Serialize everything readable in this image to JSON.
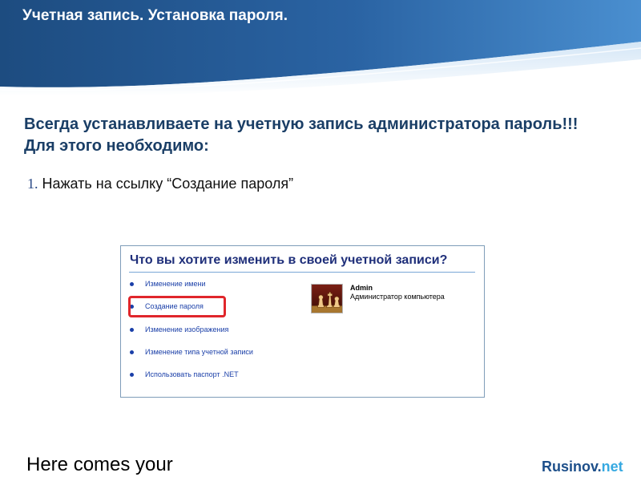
{
  "slide": {
    "title": "Учетная запись. Установка пароля.",
    "subtitle": "Всегда устанавливаете на учетную запись администратора пароль!!! Для этого необходимо:",
    "step_number": "1.",
    "step_text": " Нажать на ссылку “Создание пароля”"
  },
  "screenshot": {
    "heading": "Что вы хотите изменить в своей учетной записи?",
    "tasks": [
      {
        "label": "Изменение имени"
      },
      {
        "label": "Создание пароля"
      },
      {
        "label": "Изменение изображения"
      },
      {
        "label": "Изменение типа учетной записи"
      },
      {
        "label": "Использовать паспорт .NET"
      }
    ],
    "highlighted_task": "Создание пароля",
    "account": {
      "name": "Admin",
      "role": "Администратор компьютера",
      "avatar_icon": "chess-pieces-icon"
    }
  },
  "footer": {
    "text": "Here comes your",
    "brand_main": "Rusinov.",
    "brand_tld": "net"
  },
  "colors": {
    "banner_dark": "#1e4f86",
    "banner_light": "#3b7cc2",
    "subtitle": "#1a3e66",
    "link": "#1a3fa8",
    "highlight": "#e0262b",
    "brand": "#1d4f8a",
    "brand_accent": "#36a9e1"
  }
}
